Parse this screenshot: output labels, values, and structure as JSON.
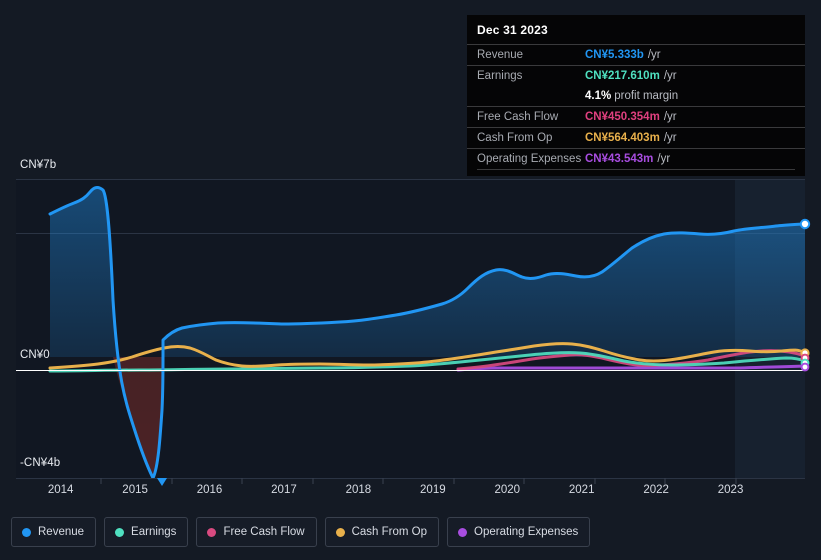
{
  "theme": {
    "background": "#141a24",
    "plot_background": "#111722",
    "grid_color": "#2b3444",
    "axis_color": "#ffffff",
    "forecast_band": "#16202e"
  },
  "tooltip": {
    "title": "Dec 31 2023",
    "rows": [
      {
        "label": "Revenue",
        "value": "CN¥5.333b",
        "unit": "/yr",
        "color": "#2196f3"
      },
      {
        "label": "Earnings",
        "value": "CN¥217.610m",
        "unit": "/yr",
        "color": "#4fe0c0"
      },
      {
        "label": "Free Cash Flow",
        "value": "CN¥450.354m",
        "unit": "/yr",
        "color": "#e0407f"
      },
      {
        "label": "Cash From Op",
        "value": "CN¥564.403m",
        "unit": "/yr",
        "color": "#e8b04b"
      },
      {
        "label": "Operating Expenses",
        "value": "CN¥43.543m",
        "unit": "/yr",
        "color": "#a84de0"
      }
    ],
    "profit_margin_value": "4.1%",
    "profit_margin_label": "profit margin"
  },
  "legend": {
    "items": [
      {
        "label": "Revenue",
        "color": "#2196f3"
      },
      {
        "label": "Earnings",
        "color": "#4fe0c0"
      },
      {
        "label": "Free Cash Flow",
        "color": "#d94a80"
      },
      {
        "label": "Cash From Op",
        "color": "#e8b04b"
      },
      {
        "label": "Operating Expenses",
        "color": "#a84de0"
      }
    ]
  },
  "chart_data": {
    "type": "area",
    "title": "",
    "xlabel": "",
    "ylabel": "",
    "currency": "CN¥",
    "grid": true,
    "legend_position": "bottom",
    "ylim": [
      -4,
      7
    ],
    "y_ticks": [
      7,
      0,
      -4
    ],
    "y_tick_labels": [
      "CN¥7b",
      "CN¥0",
      "-CN¥4b"
    ],
    "xlim": [
      2013.4,
      2024.0
    ],
    "x_ticks": [
      2014,
      2015,
      2016,
      2017,
      2018,
      2019,
      2020,
      2021,
      2022,
      2023
    ],
    "x_tick_labels": [
      "2014",
      "2015",
      "2016",
      "2017",
      "2018",
      "2019",
      "2020",
      "2021",
      "2022",
      "2023"
    ],
    "forecast_start": 2023.1,
    "units": "billions CNY",
    "series": [
      {
        "name": "Revenue",
        "color": "#2196f3",
        "x": [
          2013.45,
          2013.6,
          2013.8,
          2013.95,
          2014.1,
          2014.25,
          2014.4,
          2014.55,
          2014.62,
          2014.7,
          2014.78,
          2014.9,
          2015.05,
          2015.25,
          2015.5,
          2015.8,
          2016.1,
          2016.5,
          2016.9,
          2017.3,
          2017.7,
          2018.1,
          2018.5,
          2018.9,
          2019.2,
          2019.45,
          2019.7,
          2019.95,
          2020.2,
          2020.45,
          2020.7,
          2020.95,
          2021.2,
          2021.5,
          2021.8,
          2022.1,
          2022.4,
          2022.7,
          2023.0,
          2023.3,
          2023.6,
          2023.9
        ],
        "values": [
          6.05,
          6.18,
          6.3,
          6.45,
          6.8,
          5.2,
          0.6,
          -1.1,
          -2.6,
          -4.05,
          -4.25,
          -2.0,
          0.95,
          1.35,
          1.5,
          1.5,
          1.42,
          1.4,
          1.4,
          1.45,
          1.55,
          1.7,
          1.85,
          1.95,
          2.2,
          2.6,
          2.95,
          2.8,
          3.0,
          2.95,
          2.85,
          2.9,
          3.2,
          3.9,
          4.3,
          4.55,
          4.6,
          4.68,
          4.7,
          4.85,
          5.1,
          5.333
        ]
      },
      {
        "name": "Earnings",
        "color": "#4fe0c0",
        "x": [
          2013.45,
          2014.0,
          2014.6,
          2015.2,
          2015.8,
          2016.4,
          2017.0,
          2017.6,
          2018.2,
          2018.8,
          2019.3,
          2019.8,
          2020.3,
          2020.8,
          2021.3,
          2021.8,
          2022.3,
          2022.8,
          2023.3,
          2023.9
        ],
        "values": [
          -0.08,
          -0.07,
          -0.06,
          -0.05,
          -0.04,
          -0.03,
          -0.02,
          0.0,
          0.02,
          0.04,
          0.09,
          0.14,
          0.2,
          0.26,
          0.28,
          0.22,
          0.13,
          0.1,
          0.16,
          0.218
        ]
      },
      {
        "name": "Free Cash Flow",
        "color": "#d94a80",
        "x": [
          2018.9,
          2019.2,
          2019.6,
          2020.0,
          2020.4,
          2020.8,
          2021.2,
          2021.6,
          2022.0,
          2022.4,
          2022.8,
          2023.2,
          2023.6,
          2023.9
        ],
        "values": [
          0.0,
          0.02,
          0.05,
          0.08,
          0.12,
          0.16,
          0.2,
          0.18,
          0.1,
          0.05,
          0.06,
          0.14,
          0.3,
          0.45
        ]
      },
      {
        "name": "Cash From Op",
        "color": "#e8b04b",
        "x": [
          2013.45,
          2013.9,
          2014.3,
          2014.7,
          2015.0,
          2015.3,
          2015.6,
          2015.9,
          2016.2,
          2016.6,
          2017.0,
          2017.5,
          2018.0,
          2018.5,
          2019.0,
          2019.4,
          2019.8,
          2020.2,
          2020.6,
          2021.0,
          2021.4,
          2021.8,
          2022.2,
          2022.6,
          2023.0,
          2023.4,
          2023.7,
          2023.9
        ],
        "values": [
          0.03,
          0.05,
          0.08,
          0.1,
          0.3,
          0.42,
          0.38,
          0.2,
          0.08,
          0.08,
          0.1,
          0.08,
          0.08,
          0.09,
          0.12,
          0.14,
          0.2,
          0.26,
          0.3,
          0.34,
          0.48,
          0.4,
          0.26,
          0.14,
          0.2,
          0.3,
          0.48,
          0.564
        ]
      },
      {
        "name": "Operating Expenses",
        "color": "#a84de0",
        "x": [
          2018.9,
          2019.3,
          2019.8,
          2020.3,
          2020.8,
          2021.3,
          2021.8,
          2022.3,
          2022.8,
          2023.3,
          2023.9
        ],
        "values": [
          0.0,
          0.02,
          0.03,
          0.035,
          0.04,
          0.04,
          0.04,
          0.04,
          0.04,
          0.042,
          0.0435
        ]
      }
    ],
    "end_markers": [
      {
        "name": "Revenue",
        "value": 5.333
      },
      {
        "name": "Cash From Op",
        "value": 0.564
      },
      {
        "name": "Free Cash Flow",
        "value": 0.45
      },
      {
        "name": "Earnings",
        "value": 0.218
      },
      {
        "name": "Operating Expenses",
        "value": 0.0435
      }
    ]
  }
}
